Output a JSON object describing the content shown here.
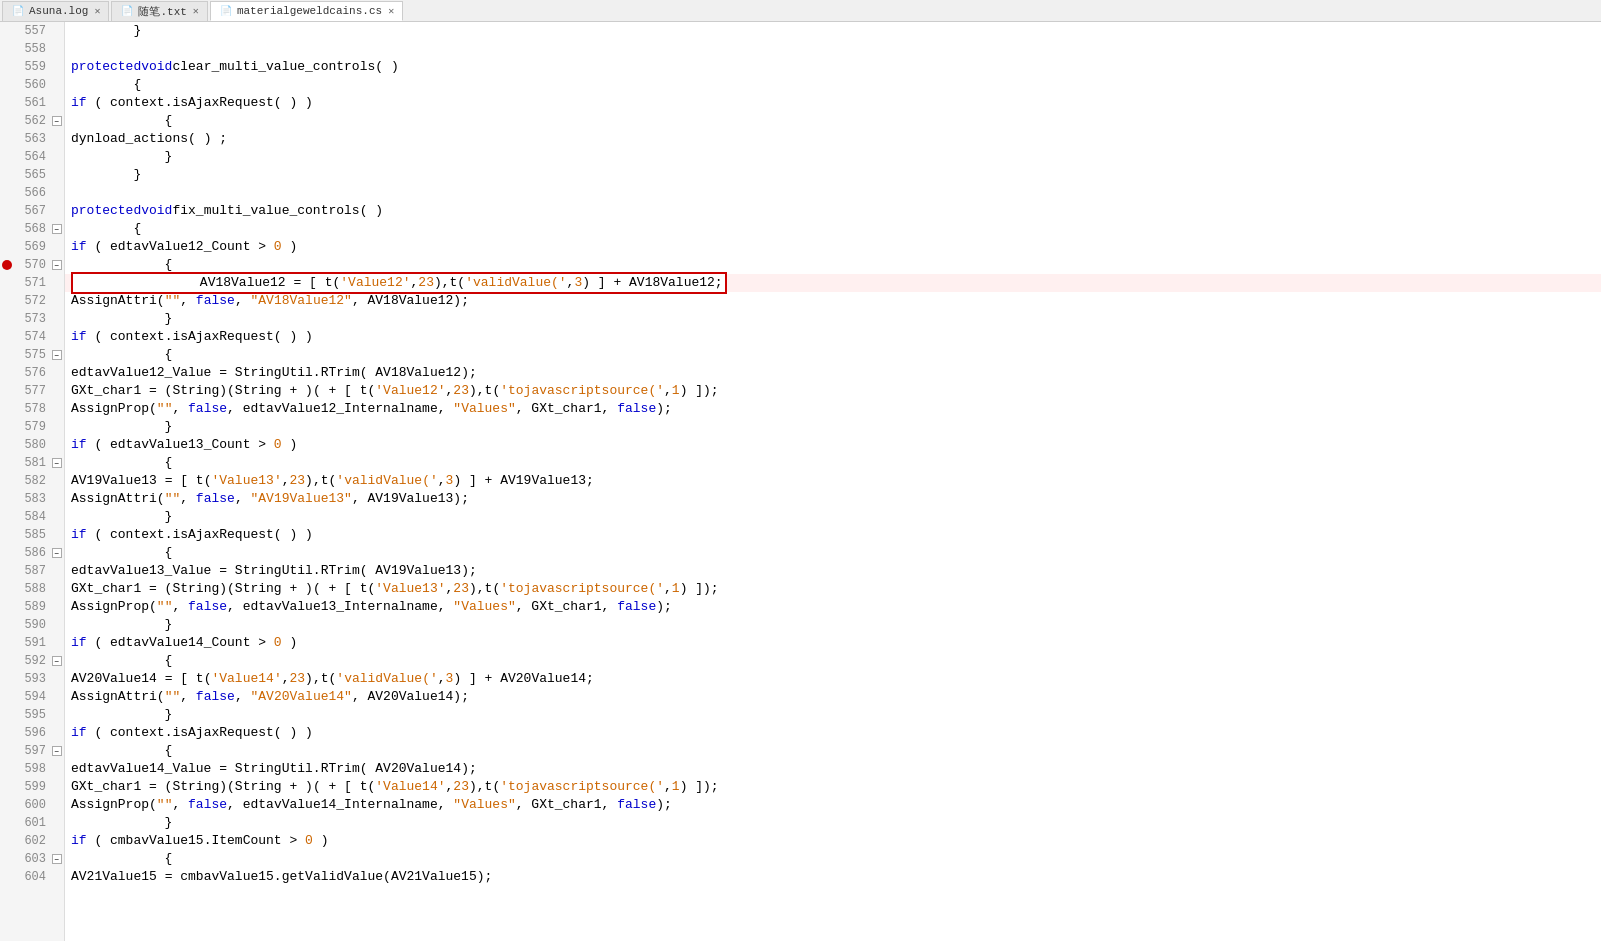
{
  "tabs": [
    {
      "id": "asuna-log",
      "label": "Asuna.log",
      "icon": "file",
      "active": false,
      "closable": true
    },
    {
      "id": "notes",
      "label": "随笔.txt",
      "icon": "file",
      "active": false,
      "closable": true
    },
    {
      "id": "material",
      "label": "materialgeweldcains.cs",
      "icon": "file-cs",
      "active": true,
      "closable": true
    }
  ],
  "lines": [
    {
      "num": 557,
      "fold": false,
      "bp": false,
      "content": "        }"
    },
    {
      "num": 558,
      "fold": false,
      "bp": false,
      "content": ""
    },
    {
      "num": 559,
      "fold": false,
      "bp": false,
      "content": "        protected void clear_multi_value_controls( )"
    },
    {
      "num": 560,
      "fold": false,
      "bp": false,
      "content": "        {"
    },
    {
      "num": 561,
      "fold": false,
      "bp": false,
      "content": "            if ( context.isAjaxRequest( ) )"
    },
    {
      "num": 562,
      "fold": true,
      "bp": false,
      "content": "            {"
    },
    {
      "num": 563,
      "fold": false,
      "bp": false,
      "content": "                dynload_actions( ) ;"
    },
    {
      "num": 564,
      "fold": false,
      "bp": false,
      "content": "            }"
    },
    {
      "num": 565,
      "fold": false,
      "bp": false,
      "content": "        }"
    },
    {
      "num": 566,
      "fold": false,
      "bp": false,
      "content": ""
    },
    {
      "num": 567,
      "fold": false,
      "bp": false,
      "content": "        protected void fix_multi_value_controls( )"
    },
    {
      "num": 568,
      "fold": true,
      "bp": false,
      "content": "        {"
    },
    {
      "num": 569,
      "fold": false,
      "bp": false,
      "content": "            if ( edtavValue12_Count > 0 )"
    },
    {
      "num": 570,
      "fold": true,
      "bp": true,
      "content": "            {",
      "error": true
    },
    {
      "num": 571,
      "fold": false,
      "bp": false,
      "content": "                AV18Value12 = [ t('Value12',23),t('validValue(',3) ] + AV18Value12;",
      "highlighted": true
    },
    {
      "num": 572,
      "fold": false,
      "bp": false,
      "content": "                AssignAttri(\"\", false, \"AV18Value12\", AV18Value12);"
    },
    {
      "num": 573,
      "fold": false,
      "bp": false,
      "content": "            }"
    },
    {
      "num": 574,
      "fold": false,
      "bp": false,
      "content": "            if ( context.isAjaxRequest( ) )"
    },
    {
      "num": 575,
      "fold": true,
      "bp": false,
      "content": "            {"
    },
    {
      "num": 576,
      "fold": false,
      "bp": false,
      "content": "                edtavValue12_Value = StringUtil.RTrim( AV18Value12);"
    },
    {
      "num": 577,
      "fold": false,
      "bp": false,
      "content": "                GXt_char1 = (String)(String + )( + [ t('Value12',23),t('tojavascriptsource(',1) ]);"
    },
    {
      "num": 578,
      "fold": false,
      "bp": false,
      "content": "                AssignProp(\"\", false, edtavValue12_Internalname, \"Values\", GXt_char1, false);"
    },
    {
      "num": 579,
      "fold": false,
      "bp": false,
      "content": "            }"
    },
    {
      "num": 580,
      "fold": false,
      "bp": false,
      "content": "            if ( edtavValue13_Count > 0 )"
    },
    {
      "num": 581,
      "fold": true,
      "bp": false,
      "content": "            {"
    },
    {
      "num": 582,
      "fold": false,
      "bp": false,
      "content": "                AV19Value13 = [ t('Value13',23),t('validValue(',3) ] + AV19Value13;"
    },
    {
      "num": 583,
      "fold": false,
      "bp": false,
      "content": "                AssignAttri(\"\", false, \"AV19Value13\", AV19Value13);"
    },
    {
      "num": 584,
      "fold": false,
      "bp": false,
      "content": "            }"
    },
    {
      "num": 585,
      "fold": false,
      "bp": false,
      "content": "            if ( context.isAjaxRequest( ) )"
    },
    {
      "num": 586,
      "fold": true,
      "bp": false,
      "content": "            {"
    },
    {
      "num": 587,
      "fold": false,
      "bp": false,
      "content": "                edtavValue13_Value = StringUtil.RTrim( AV19Value13);"
    },
    {
      "num": 588,
      "fold": false,
      "bp": false,
      "content": "                GXt_char1 = (String)(String + )( + [ t('Value13',23),t('tojavascriptsource(',1) ]);"
    },
    {
      "num": 589,
      "fold": false,
      "bp": false,
      "content": "                AssignProp(\"\", false, edtavValue13_Internalname, \"Values\", GXt_char1, false);"
    },
    {
      "num": 590,
      "fold": false,
      "bp": false,
      "content": "            }"
    },
    {
      "num": 591,
      "fold": false,
      "bp": false,
      "content": "            if ( edtavValue14_Count > 0 )"
    },
    {
      "num": 592,
      "fold": true,
      "bp": false,
      "content": "            {"
    },
    {
      "num": 593,
      "fold": false,
      "bp": false,
      "content": "                AV20Value14 = [ t('Value14',23),t('validValue(',3) ] + AV20Value14;"
    },
    {
      "num": 594,
      "fold": false,
      "bp": false,
      "content": "                AssignAttri(\"\", false, \"AV20Value14\", AV20Value14);"
    },
    {
      "num": 595,
      "fold": false,
      "bp": false,
      "content": "            }"
    },
    {
      "num": 596,
      "fold": false,
      "bp": false,
      "content": "            if ( context.isAjaxRequest( ) )"
    },
    {
      "num": 597,
      "fold": true,
      "bp": false,
      "content": "            {"
    },
    {
      "num": 598,
      "fold": false,
      "bp": false,
      "content": "                edtavValue14_Value = StringUtil.RTrim( AV20Value14);"
    },
    {
      "num": 599,
      "fold": false,
      "bp": false,
      "content": "                GXt_char1 = (String)(String + )( + [ t('Value14',23),t('tojavascriptsource(',1) ]);"
    },
    {
      "num": 600,
      "fold": false,
      "bp": false,
      "content": "                AssignProp(\"\", false, edtavValue14_Internalname, \"Values\", GXt_char1, false);"
    },
    {
      "num": 601,
      "fold": false,
      "bp": false,
      "content": "            }"
    },
    {
      "num": 602,
      "fold": false,
      "bp": false,
      "content": "            if ( cmbavValue15.ItemCount > 0 )"
    },
    {
      "num": 603,
      "fold": true,
      "bp": false,
      "content": "            {"
    },
    {
      "num": 604,
      "fold": false,
      "bp": false,
      "content": "                AV21Value15 = cmbavValue15.getValidValue(AV21Value15);"
    }
  ],
  "colors": {
    "keyword": "#0000cc",
    "string": "#cc6600",
    "number": "#cc6600",
    "normal": "#000000",
    "comment": "#008000",
    "linenum": "#888888",
    "gutter_bg": "#f5f5f5",
    "highlight_bg": "#fff0f0",
    "error_border": "#cc0000",
    "error_bp": "#cc0000"
  }
}
